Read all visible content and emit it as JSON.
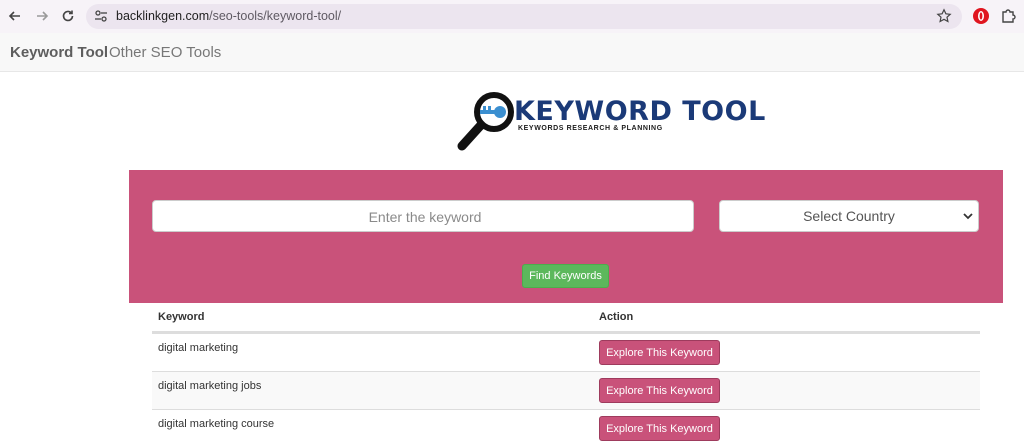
{
  "browser": {
    "url_host": "backlinkgen.com",
    "url_path": "/seo-tools/keyword-tool/",
    "icons": [
      "back-icon",
      "forward-icon",
      "reload-icon",
      "site-info-icon",
      "star-icon",
      "opera-extension-icon",
      "extensions-icon"
    ]
  },
  "nav": {
    "brand": "Keyword Tool",
    "link": "Other SEO Tools"
  },
  "logo": {
    "title": "KEYWORD TOOL",
    "subtitle": "KEYWORDS RESEARCH & PLANNING"
  },
  "search": {
    "placeholder": "Enter the keyword",
    "value": "",
    "country_selected": "Select Country",
    "button": "Find Keywords"
  },
  "table": {
    "headers": [
      "Keyword",
      "Action"
    ],
    "rows": [
      {
        "keyword": "digital marketing",
        "action": "Explore This Keyword"
      },
      {
        "keyword": "digital marketing jobs",
        "action": "Explore This Keyword"
      },
      {
        "keyword": "digital marketing course",
        "action": "Explore This Keyword"
      }
    ]
  },
  "colors": {
    "accent_pink": "#c9527a",
    "button_green": "#5cb85c",
    "logo_blue": "#1b3a78"
  }
}
